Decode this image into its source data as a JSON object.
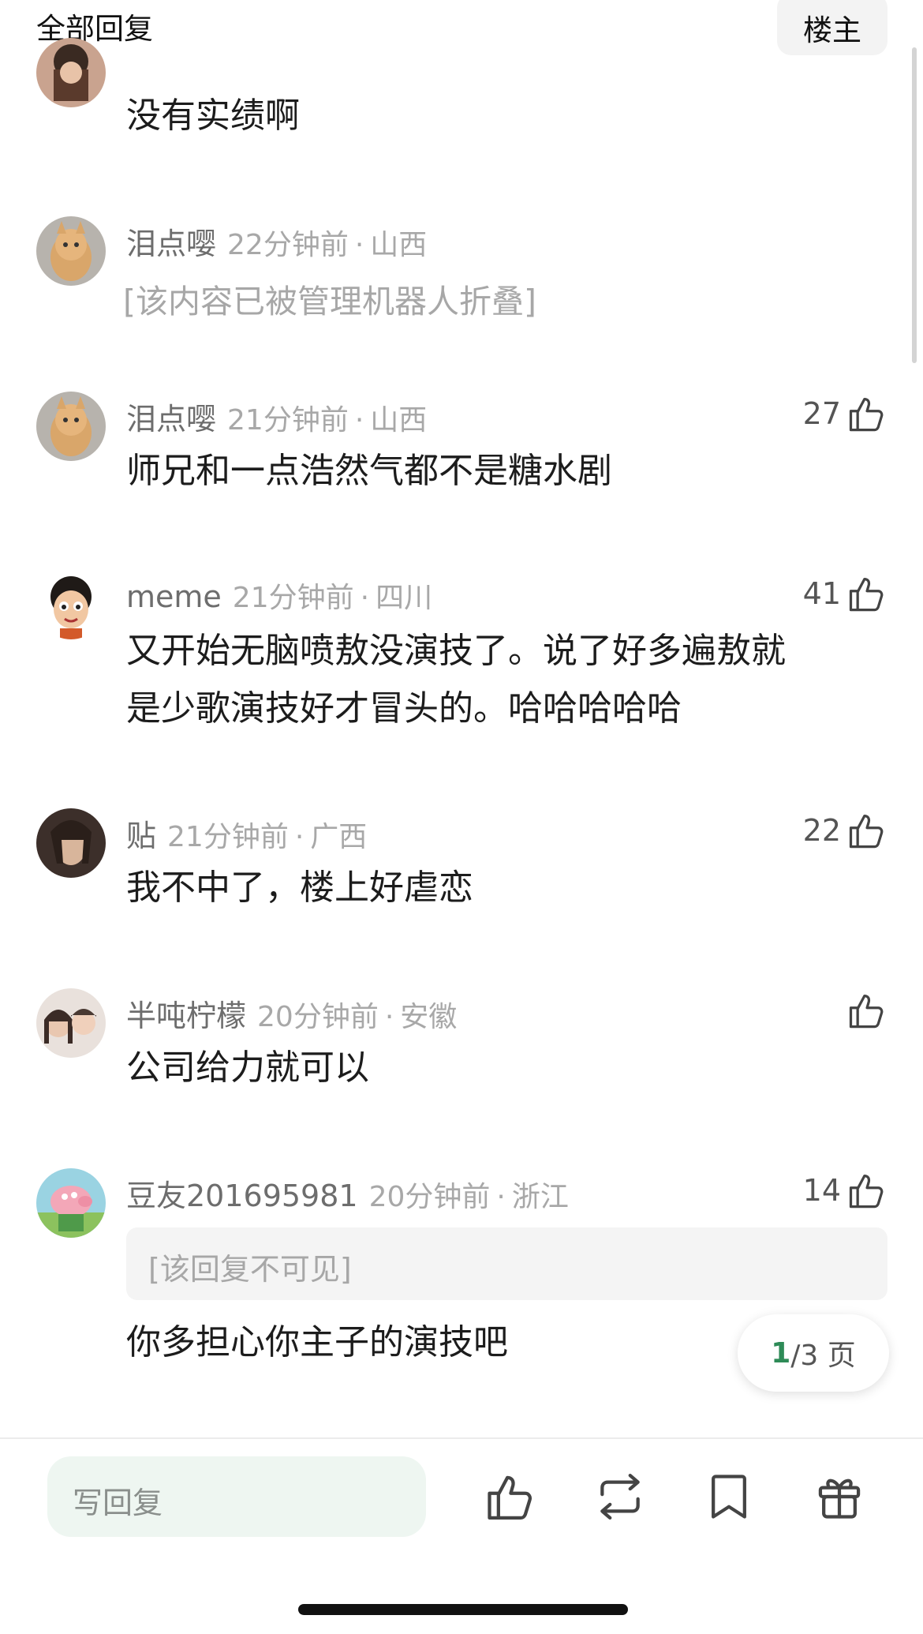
{
  "header": {
    "title": "全部回复",
    "op_tab": "楼主"
  },
  "comments": [
    {
      "text": "没有实绩啊"
    },
    {
      "username": "泪点嘤",
      "time": "22分钟前",
      "sep": "·",
      "location": "山西",
      "folded_text": "[该内容已被管理机器人折叠]"
    },
    {
      "username": "泪点嘤",
      "time": "21分钟前",
      "sep": "·",
      "location": "山西",
      "likes": "27",
      "text": "师兄和一点浩然气都不是糖水剧"
    },
    {
      "username": "meme",
      "time": "21分钟前",
      "sep": "·",
      "location": "四川",
      "likes": "41",
      "text_line1": "又开始无脑喷敖没演技了。说了好多遍敖就",
      "text_line2": "是少歌演技好才冒头的。哈哈哈哈哈"
    },
    {
      "username": "贴",
      "time": "21分钟前",
      "sep": "·",
      "location": "广西",
      "likes": "22",
      "text": "我不中了，楼上好虐恋"
    },
    {
      "username": "半吨柠檬",
      "time": "20分钟前",
      "sep": "·",
      "location": "安徽",
      "text": "公司给力就可以"
    },
    {
      "username": "豆友201695981",
      "time": "20分钟前",
      "sep": "·",
      "location": "浙江",
      "likes": "14",
      "quote": "[该回复不可见]",
      "text": "你多担心你主子的演技吧"
    }
  ],
  "pager": {
    "current": "1",
    "total_text": "/3 页"
  },
  "bottom_bar": {
    "reply_placeholder": "写回复",
    "icons": [
      "thumbs-up-icon",
      "repost-icon",
      "bookmark-icon",
      "gift-icon"
    ]
  },
  "colors": {
    "accent_green": "#2e8b57",
    "input_bg": "#eef6f1"
  }
}
